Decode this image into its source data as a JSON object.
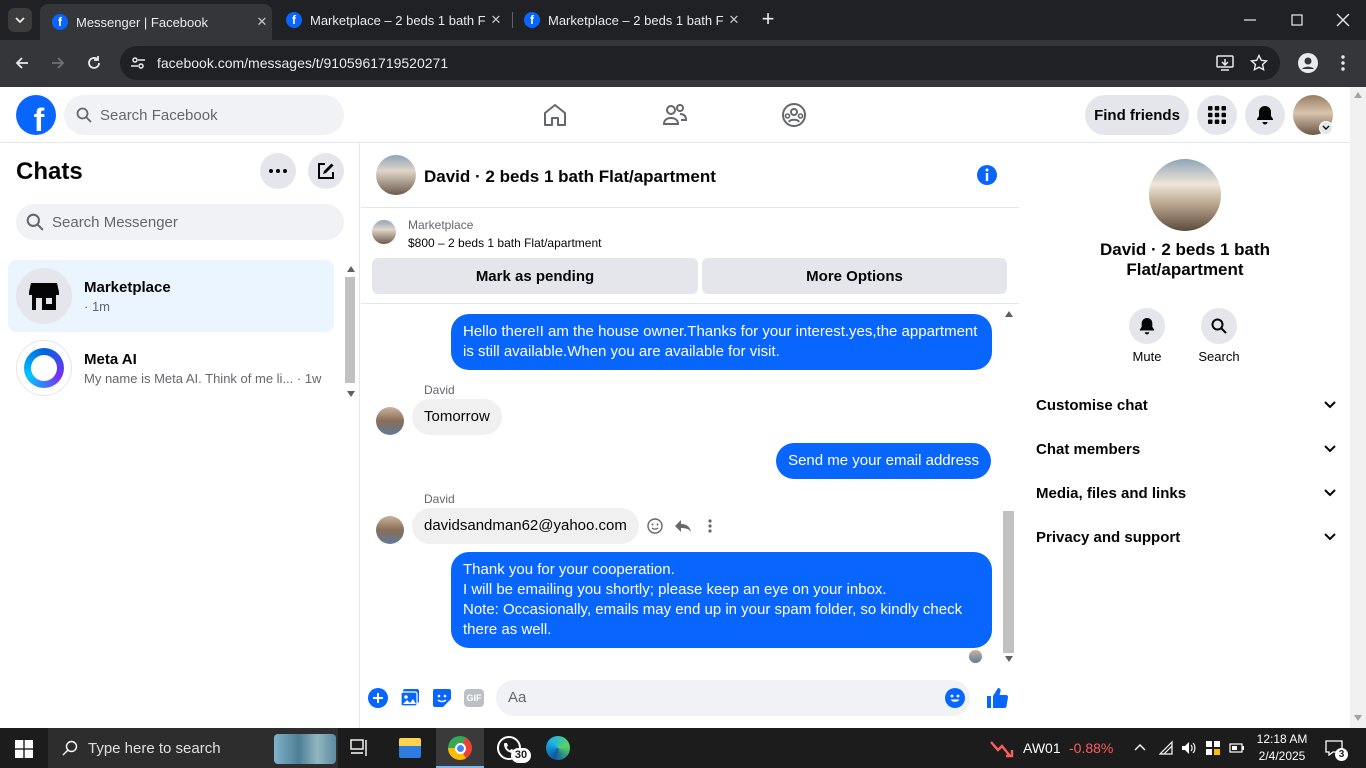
{
  "browser": {
    "tabs": [
      {
        "title": "Messenger | Facebook"
      },
      {
        "title": "Marketplace – 2 beds 1 bath Fla"
      },
      {
        "title": "Marketplace – 2 beds 1 bath Fla"
      }
    ],
    "url": "facebook.com/messages/t/9105961719520271"
  },
  "header": {
    "search_placeholder": "Search Facebook",
    "find_friends": "Find friends"
  },
  "sidebar": {
    "title": "Chats",
    "search_placeholder": "Search Messenger",
    "chats": [
      {
        "name": "Marketplace",
        "preview": "· 1m"
      },
      {
        "name": "Meta AI",
        "preview": "My name is Meta AI. Think of me li... · 1w"
      }
    ]
  },
  "conversation": {
    "title": "David · 2 beds 1 bath Flat/apartment",
    "listing_source": "Marketplace",
    "listing_title": "$800 – 2 beds 1 bath Flat/apartment",
    "mark_pending": "Mark as pending",
    "more_options": "More Options",
    "messages": [
      {
        "text": "Hello there!I am the house owner.Thanks for your interest.yes,the appartment is still available.When you are available for visit."
      },
      {
        "sender": "David",
        "text": "Tomorrow"
      },
      {
        "text": "Send me your email address"
      },
      {
        "sender": "David",
        "text": "davidsandman62@yahoo.com"
      },
      {
        "text": "Thank you for your cooperation.\nI will be emailing you shortly; please keep an eye on your inbox.\nNote: Occasionally, emails may end up in your spam folder, so kindly check there as well."
      }
    ],
    "composer_placeholder": "Aa"
  },
  "details": {
    "name": "David · 2 beds 1 bath Flat/apartment",
    "mute": "Mute",
    "search": "Search",
    "sections": [
      "Customise chat",
      "Chat members",
      "Media, files and links",
      "Privacy and support"
    ]
  },
  "taskbar": {
    "search_placeholder": "Type here to search",
    "whatsapp_badge": "30",
    "stock_name": "AW01",
    "stock_change": "-0.88%",
    "time": "12:18 AM",
    "date": "2/4/2025",
    "notification_count": "3"
  },
  "colors": {
    "accent": "#0866ff",
    "stock_negative": "#ff5c5c"
  }
}
